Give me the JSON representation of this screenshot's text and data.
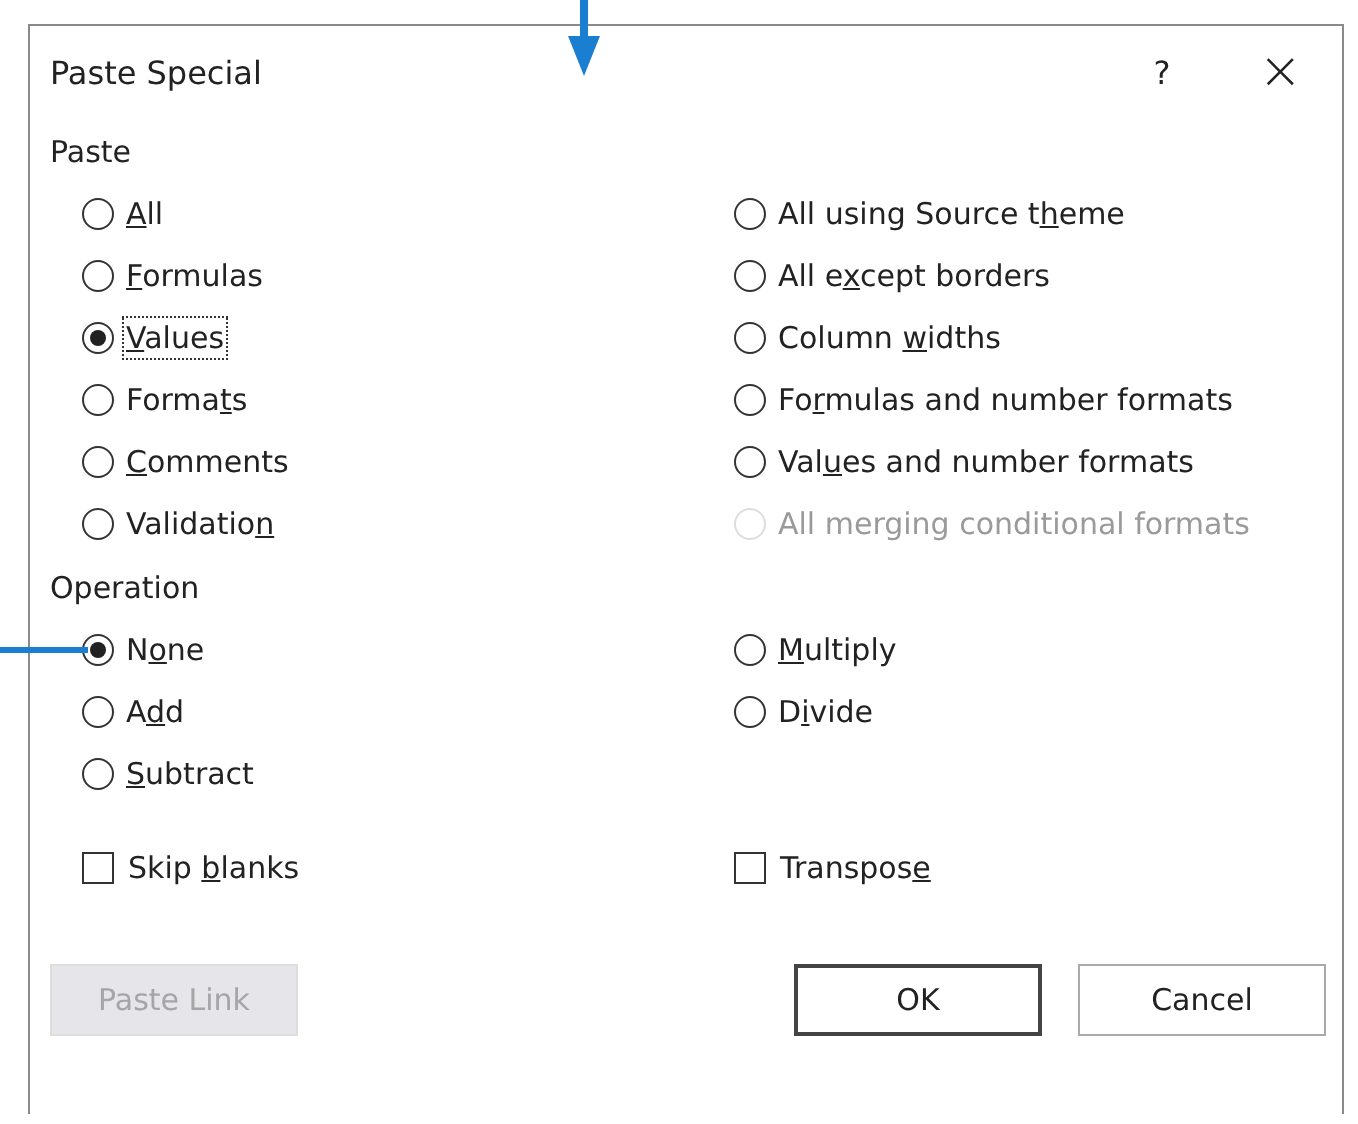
{
  "window": {
    "title": "Paste Special",
    "help": "?",
    "close": "×"
  },
  "paste": {
    "heading": "Paste",
    "columns": [
      [
        {
          "label": {
            "key": "A",
            "after": "ll"
          },
          "selected": false,
          "disabled": false,
          "focused": false
        },
        {
          "label": {
            "key": "F",
            "after": "ormulas"
          },
          "selected": false,
          "disabled": false,
          "focused": false
        },
        {
          "label": {
            "key": "V",
            "after": "alues"
          },
          "selected": true,
          "disabled": false,
          "focused": true
        },
        {
          "label": {
            "before": "Forma",
            "key": "t",
            "after": "s"
          },
          "selected": false,
          "disabled": false,
          "focused": false
        },
        {
          "label": {
            "key": "C",
            "after": "omments"
          },
          "selected": false,
          "disabled": false,
          "focused": false
        },
        {
          "label": {
            "before": "Validatio",
            "key": "n"
          },
          "selected": false,
          "disabled": false,
          "focused": false
        }
      ],
      [
        {
          "label": {
            "before": "All using Source t",
            "key": "h",
            "after": "eme"
          },
          "selected": false,
          "disabled": false,
          "focused": false
        },
        {
          "label": {
            "before": "All e",
            "key": "x",
            "after": "cept borders"
          },
          "selected": false,
          "disabled": false,
          "focused": false
        },
        {
          "label": {
            "before": "Column ",
            "key": "w",
            "after": "idths"
          },
          "selected": false,
          "disabled": false,
          "focused": false
        },
        {
          "label": {
            "before": "Fo",
            "key": "r",
            "after": "mulas and number formats"
          },
          "selected": false,
          "disabled": false,
          "focused": false
        },
        {
          "label": {
            "before": "Val",
            "key": "u",
            "after": "es and number formats"
          },
          "selected": false,
          "disabled": false,
          "focused": false
        },
        {
          "label": {
            "before": "All merging conditional formats"
          },
          "selected": false,
          "disabled": true,
          "focused": false
        }
      ]
    ]
  },
  "operation": {
    "heading": "Operation",
    "columns": [
      [
        {
          "label": {
            "before": "N",
            "key": "o",
            "after": "ne"
          },
          "selected": true,
          "disabled": false,
          "focused": false
        },
        {
          "label": {
            "before": "A",
            "key": "d",
            "after": "d"
          },
          "selected": false,
          "disabled": false,
          "focused": false
        },
        {
          "label": {
            "key": "S",
            "after": "ubtract"
          },
          "selected": false,
          "disabled": false,
          "focused": false
        }
      ],
      [
        {
          "label": {
            "key": "M",
            "after": "ultiply"
          },
          "selected": false,
          "disabled": false,
          "focused": false
        },
        {
          "label": {
            "before": "D",
            "key": "i",
            "after": "vide"
          },
          "selected": false,
          "disabled": false,
          "focused": false
        }
      ]
    ]
  },
  "checkboxes": [
    {
      "label": {
        "before": "Skip ",
        "key": "b",
        "after": "lanks"
      },
      "checked": false
    },
    {
      "label": {
        "before": "Transpos",
        "key": "e"
      },
      "checked": false
    }
  ],
  "buttons": [
    {
      "label": "Paste Link",
      "disabled": true,
      "default": false
    },
    {
      "label": "OK",
      "disabled": false,
      "default": true
    },
    {
      "label": "Cancel",
      "disabled": false,
      "default": false
    }
  ]
}
